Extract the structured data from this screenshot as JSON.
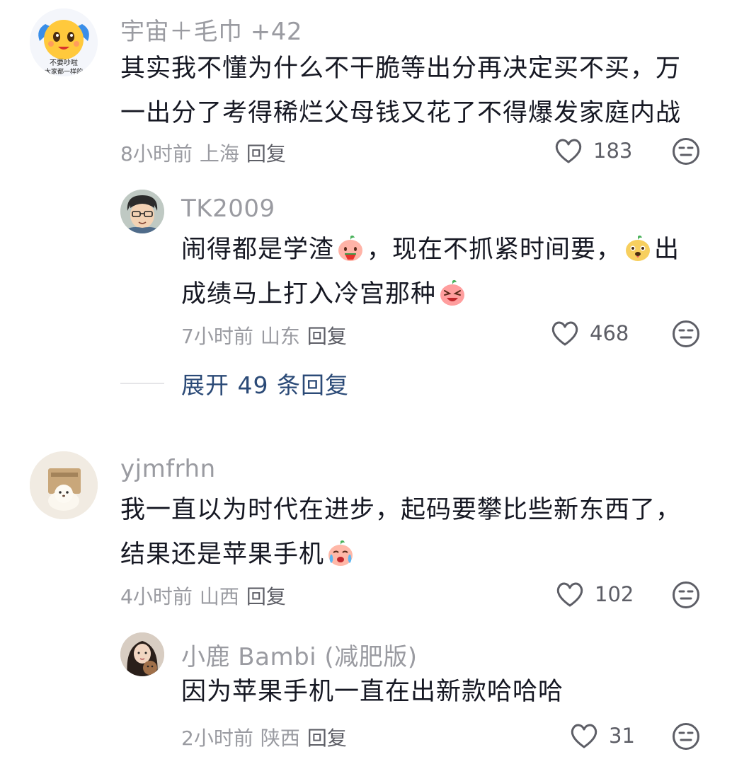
{
  "comments": [
    {
      "username": "宇宙＋毛巾 +42",
      "avatar_text": [
        "不要吵啦",
        "大家都一样的"
      ],
      "text_lines": [
        "其实我不懂为什么不干脆等出分再决定买不买，万",
        "一出分了考得稀烂父母钱又花了不得爆发家庭内战"
      ],
      "time": "8小时前",
      "location": "上海",
      "reply_label": "回复",
      "likes": "183"
    },
    {
      "username": "TK2009",
      "text_parts": [
        "闹得都是学渣",
        "，现在不抓紧时间要，",
        "出",
        "成绩马上打入冷宫那种"
      ],
      "time": "7小时前",
      "location": "山东",
      "reply_label": "回复",
      "likes": "468"
    },
    {
      "username": "yjmfrhn",
      "text_lines": [
        "我一直以为时代在进步，起码要攀比些新东西了，",
        "结果还是苹果手机"
      ],
      "time": "4小时前",
      "location": "山西",
      "reply_label": "回复",
      "likes": "102"
    },
    {
      "username": "小鹿 Bambi (减肥版)",
      "text_lines": [
        "因为苹果手机一直在出新款哈哈哈"
      ],
      "time": "2小时前",
      "location": "陕西",
      "reply_label": "回复",
      "likes": "31"
    }
  ],
  "expand_replies": "展开 49 条回复",
  "colors": {
    "meta": "#9a9ba1",
    "text": "#161823",
    "expand": "#2b4a77"
  },
  "icons": {
    "like": "heart-outline-icon",
    "dislike": "neutral-face-icon"
  }
}
